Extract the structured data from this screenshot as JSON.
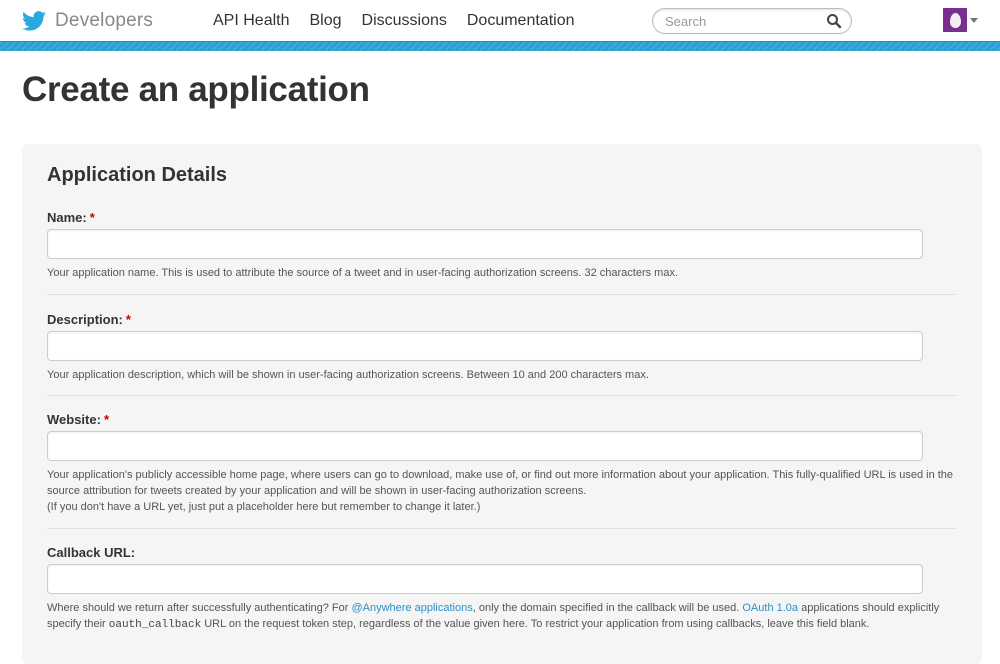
{
  "header": {
    "brand": "Developers",
    "nav": [
      "API Health",
      "Blog",
      "Discussions",
      "Documentation"
    ],
    "search_placeholder": "Search"
  },
  "page_title": "Create an application",
  "form": {
    "section_title": "Application Details",
    "required_mark": "*",
    "fields": [
      {
        "label": "Name:",
        "required": true,
        "value": "",
        "help": "Your application name. This is used to attribute the source of a tweet and in user-facing authorization screens. 32 characters max."
      },
      {
        "label": "Description:",
        "required": true,
        "value": "",
        "help": "Your application description, which will be shown in user-facing authorization screens. Between 10 and 200 characters max."
      },
      {
        "label": "Website:",
        "required": true,
        "value": "",
        "help_line1": "Your application's publicly accessible home page, where users can go to download, make use of, or find out more information about your application. This fully-qualified URL is used in the source attribution for tweets created by your application and will be shown in user-facing authorization screens.",
        "help_line2": "(If you don't have a URL yet, just put a placeholder here but remember to change it later.)"
      },
      {
        "label": "Callback URL:",
        "required": false,
        "value": "",
        "help_parts": {
          "p1": "Where should we return after successfully authenticating? For ",
          "link1": "@Anywhere applications",
          "p2": ", only the domain specified in the callback will be used. ",
          "link2": "OAuth 1.0a",
          "p3": " applications should explicitly specify their ",
          "code": "oauth_callback",
          "p4": " URL on the request token step, regardless of the value given here. To restrict your application from using callbacks, leave this field blank."
        }
      }
    ]
  },
  "colors": {
    "accent": "#2a9fd6",
    "link": "#2a91c9",
    "required": "#cc0000",
    "avatar": "#7a2f8f"
  },
  "icons": [
    "twitter-bird-icon",
    "search-icon",
    "avatar-egg-icon",
    "chevron-down-icon"
  ]
}
